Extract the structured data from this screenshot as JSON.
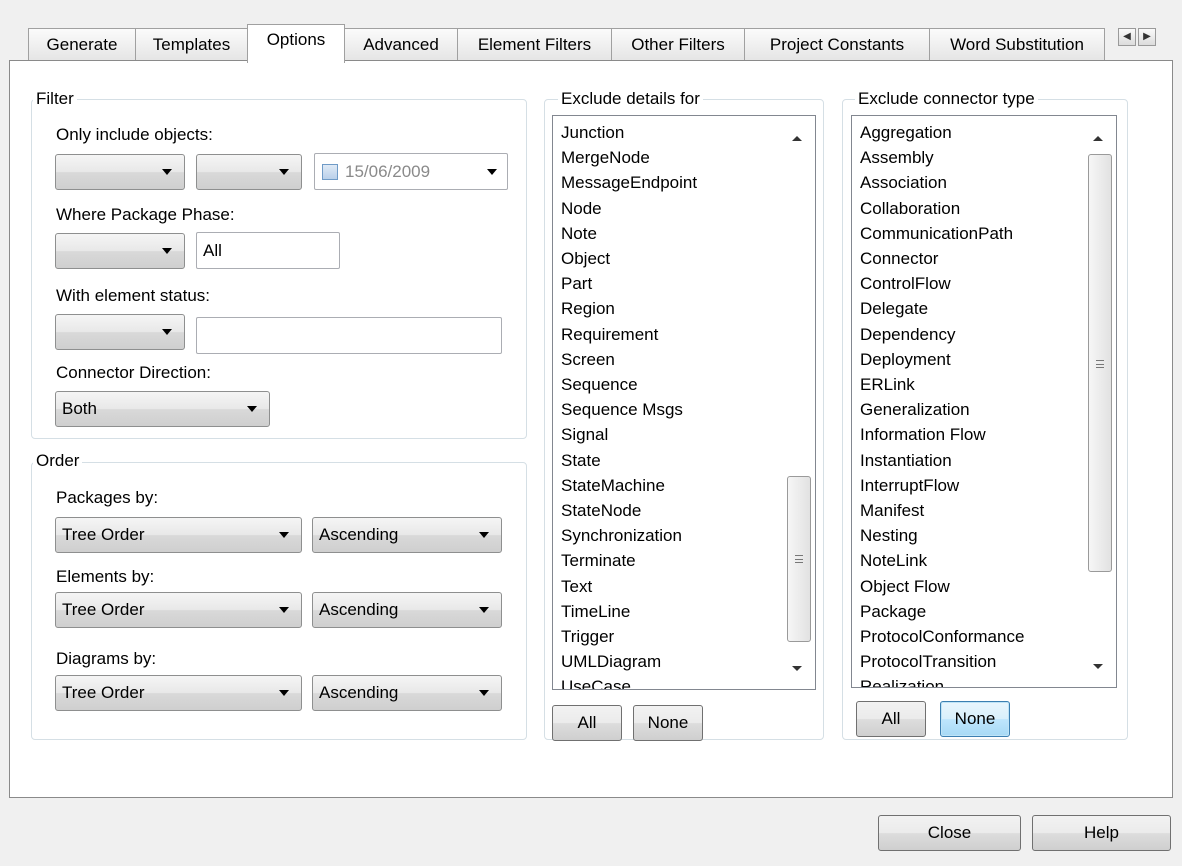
{
  "tabs": [
    "Generate",
    "Templates",
    "Options",
    "Advanced",
    "Element Filters",
    "Other Filters",
    "Project Constants",
    "Word Substitution"
  ],
  "active_tab": "Options",
  "filter": {
    "title": "Filter",
    "only_include_label": "Only include objects:",
    "only_include_combo1": "",
    "only_include_combo2": "",
    "date_value": "15/06/2009",
    "where_phase_label": "Where Package Phase:",
    "phase_combo": "",
    "phase_value": "All",
    "element_status_label": "With element status:",
    "status_combo": "",
    "status_value": "",
    "connector_direction_label": "Connector Direction:",
    "connector_direction_value": "Both"
  },
  "order": {
    "title": "Order",
    "packages_label": "Packages by:",
    "packages_by": "Tree Order",
    "packages_dir": "Ascending",
    "elements_label": "Elements by:",
    "elements_by": "Tree Order",
    "elements_dir": "Ascending",
    "diagrams_label": "Diagrams by:",
    "diagrams_by": "Tree Order",
    "diagrams_dir": "Ascending"
  },
  "exclude_details": {
    "title": "Exclude details for",
    "items": [
      "Junction",
      "MergeNode",
      "MessageEndpoint",
      "Node",
      "Note",
      "Object",
      "Part",
      "Region",
      "Requirement",
      "Screen",
      "Sequence",
      "Sequence Msgs",
      "Signal",
      "State",
      "StateMachine",
      "StateNode",
      "Synchronization",
      "Terminate",
      "Text",
      "TimeLine",
      "Trigger",
      "UMLDiagram",
      "UseCase"
    ],
    "all_label": "All",
    "none_label": "None"
  },
  "exclude_connector": {
    "title": "Exclude connector type",
    "items": [
      "Aggregation",
      "Assembly",
      "Association",
      "Collaboration",
      "CommunicationPath",
      "Connector",
      "ControlFlow",
      "Delegate",
      "Dependency",
      "Deployment",
      "ERLink",
      "Generalization",
      "Information Flow",
      "Instantiation",
      "InterruptFlow",
      "Manifest",
      "Nesting",
      "NoteLink",
      "Object Flow",
      "Package",
      "ProtocolConformance",
      "ProtocolTransition",
      "Realization"
    ],
    "all_label": "All",
    "none_label": "None"
  },
  "footer": {
    "close_label": "Close",
    "help_label": "Help"
  },
  "icons": {
    "tab_scroll_left": "scroll-left-icon",
    "tab_scroll_right": "scroll-right-icon",
    "dropdown": "chevron-down-icon",
    "date_checkbox": "checkbox-icon"
  }
}
